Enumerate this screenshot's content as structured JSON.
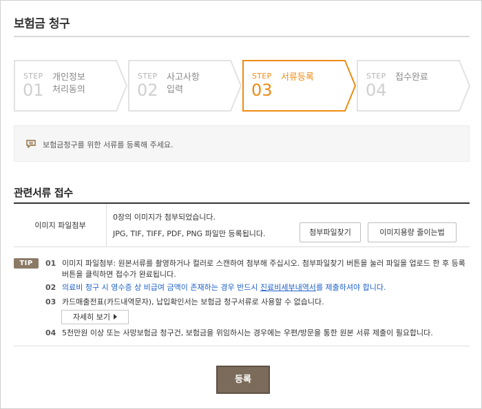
{
  "page": {
    "title": "보험금 청구"
  },
  "steps": [
    {
      "label": "STEP",
      "number": "01",
      "text": "개인정보\n처리동의",
      "active": false
    },
    {
      "label": "STEP",
      "number": "02",
      "text": "사고사항\n입력",
      "active": false
    },
    {
      "label": "STEP",
      "number": "03",
      "text": "서류등록",
      "active": true
    },
    {
      "label": "STEP",
      "number": "04",
      "text": "접수완료",
      "active": false
    }
  ],
  "notice": {
    "text": "보험금청구를 위한 서류를 등록해 주세요."
  },
  "section": {
    "title": "관련서류 접수"
  },
  "attach": {
    "header": "이미지 파일첨부",
    "status": "0장의 이미지가 첨부되었습니다.",
    "formats": "JPG, TIF, TIFF, PDF, PNG 파일만 등록됩니다.",
    "find_button": "첨부파일찾기",
    "reduce_button": "이미지용량 줄이는법"
  },
  "tips": {
    "badge": "TIP",
    "items": [
      {
        "num": "01",
        "text": "이미지 파일첨부: 원본서류를 촬영하거나 컬러로 스캔하여 첨부해 주십시오. 첨부파일찾기 버튼을 눌러 파일을 업로드 한 후 등록 버튼을 클릭하면 접수가 완료됩니다."
      },
      {
        "num": "02",
        "text_before": "의료비 청구 시 영수증 상 비급여 금액이 존재하는 경우 반드시 ",
        "text_link": "진료비세부내역서",
        "text_after": "를 제출하셔야 합니다."
      },
      {
        "num": "03",
        "text": "카드매출전표(카드내역문자), 납입확인서는 보험금 청구서류로 사용할 수 없습니다."
      },
      {
        "num": "04",
        "text": "5천만원 이상 또는 사망보험금 청구건, 보험금을 위임하시는 경우에는 우편/방문을 통한 원본 서류 제출이 필요합니다."
      }
    ],
    "detail_button": "자세히 보기"
  },
  "submit": {
    "label": "등록"
  },
  "colors": {
    "accent": "#ef8a12",
    "brown": "#7b6b5a",
    "link": "#1a5fc9"
  }
}
